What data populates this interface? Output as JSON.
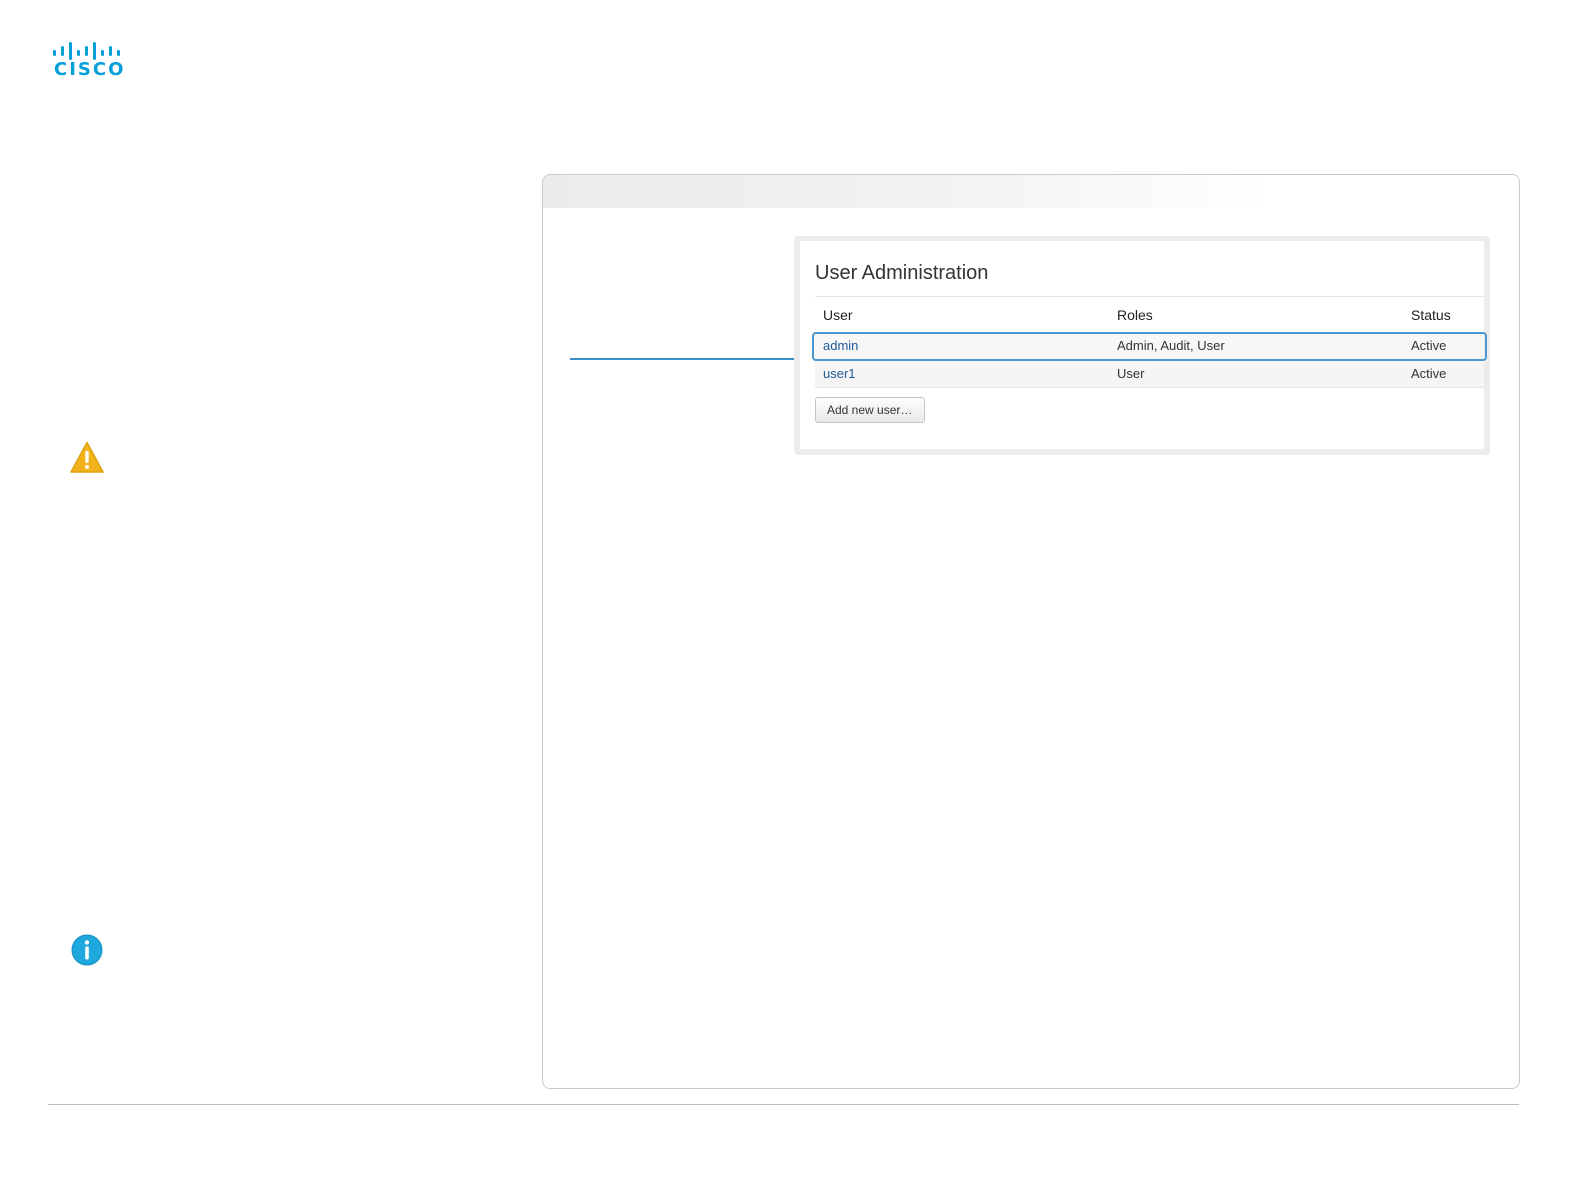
{
  "brand": {
    "logo_text": "CISCO",
    "logo_icon": "cisco-bridge-logo-icon",
    "color": "#049fd9"
  },
  "sidebar_icons": {
    "warning": "warning-triangle-icon",
    "info": "info-circle-icon",
    "warning_color": "#f2b21b",
    "info_color": "#1fa8de"
  },
  "user_admin": {
    "title": "User Administration",
    "columns": {
      "user": "User",
      "roles": "Roles",
      "status": "Status"
    },
    "rows": [
      {
        "user": "admin",
        "roles": "Admin, Audit, User",
        "status": "Active",
        "highlighted": true
      },
      {
        "user": "user1",
        "roles": "User",
        "status": "Active",
        "highlighted": false
      }
    ],
    "add_button_label": "Add new user…"
  },
  "colors": {
    "link": "#1f5a96",
    "highlight_border": "#4a97d0",
    "callout_line": "#3a8dc5"
  }
}
